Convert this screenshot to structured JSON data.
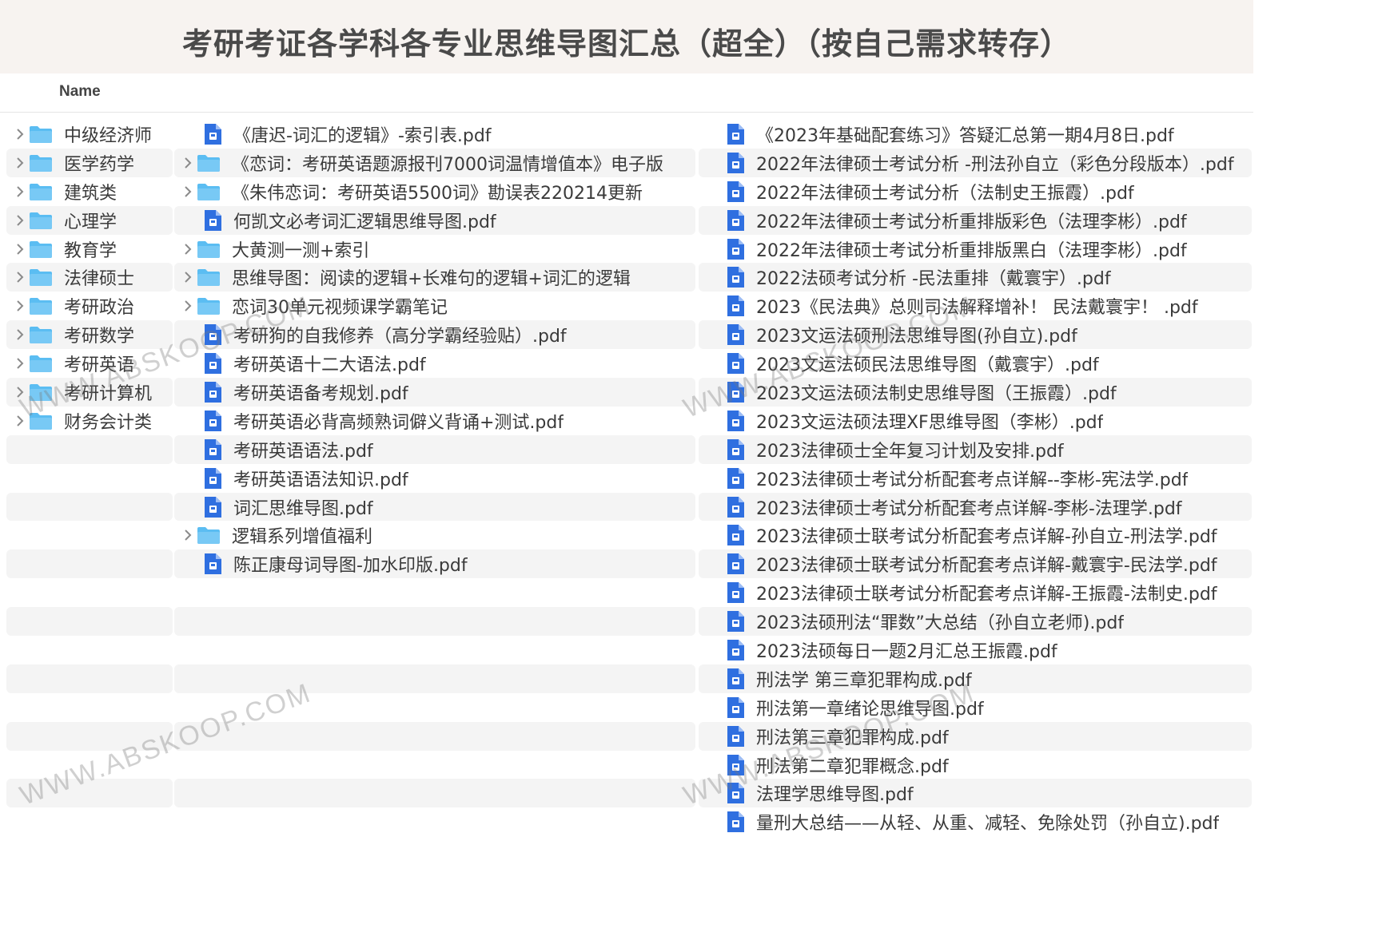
{
  "page_title": "考研考证各学科各专业思维导图汇总（超全）（按自己需求转存）",
  "header": {
    "name_label": "Name"
  },
  "watermark_text": "WWW.ABSKOOP.COM",
  "sidebar": {
    "items": [
      {
        "label": "中级经济师"
      },
      {
        "label": "医学药学"
      },
      {
        "label": "建筑类"
      },
      {
        "label": "心理学"
      },
      {
        "label": "教育学"
      },
      {
        "label": "法律硕士"
      },
      {
        "label": "考研政治"
      },
      {
        "label": "考研数学"
      },
      {
        "label": "考研英语"
      },
      {
        "label": "考研计算机"
      },
      {
        "label": "财务会计类"
      }
    ]
  },
  "middle": {
    "items": [
      {
        "type": "file",
        "label": "《唐迟-词汇的逻辑》-索引表.pdf"
      },
      {
        "type": "folder",
        "label": "《恋词：考研英语题源报刊7000词温情增值本》电子版"
      },
      {
        "type": "folder",
        "label": "《朱伟恋词：考研英语5500词》勘误表220214更新"
      },
      {
        "type": "file",
        "label": "何凯文必考词汇逻辑思维导图.pdf"
      },
      {
        "type": "folder",
        "label": "大黄测一测+索引"
      },
      {
        "type": "folder",
        "label": "思维导图：阅读的逻辑+长难句的逻辑+词汇的逻辑"
      },
      {
        "type": "folder",
        "label": "恋词30单元视频课学霸笔记"
      },
      {
        "type": "file",
        "label": "考研狗的自我修养（高分学霸经验贴）.pdf"
      },
      {
        "type": "file",
        "label": "考研英语十二大语法.pdf"
      },
      {
        "type": "file",
        "label": "考研英语备考规划.pdf"
      },
      {
        "type": "file",
        "label": "考研英语必背高频熟词僻义背诵+测试.pdf"
      },
      {
        "type": "file",
        "label": "考研英语语法.pdf"
      },
      {
        "type": "file",
        "label": "考研英语语法知识.pdf"
      },
      {
        "type": "file",
        "label": "词汇思维导图.pdf"
      },
      {
        "type": "folder",
        "label": "逻辑系列增值福利"
      },
      {
        "type": "file",
        "label": "陈正康母词导图-加水印版.pdf"
      }
    ]
  },
  "right": {
    "items": [
      {
        "label": "《2023年基础配套练习》答疑汇总第一期4月8日.pdf"
      },
      {
        "label": "2022年法律硕士考试分析 -刑法孙自立（彩色分段版本）.pdf"
      },
      {
        "label": "2022年法律硕士考试分析（法制史王振霞）.pdf"
      },
      {
        "label": "2022年法律硕士考试分析重排版彩色（法理李彬）.pdf"
      },
      {
        "label": "2022年法律硕士考试分析重排版黑白（法理李彬）.pdf"
      },
      {
        "label": "2022法硕考试分析 -民法重排（戴寰宇）.pdf"
      },
      {
        "label": "2023《民法典》总则司法解释增补！ 民法戴寰宇！ .pdf"
      },
      {
        "label": "2023文运法硕刑法思维导图(孙自立).pdf"
      },
      {
        "label": "2023文运法硕民法思维导图（戴寰宇）.pdf"
      },
      {
        "label": "2023文运法硕法制史思维导图（王振霞）.pdf"
      },
      {
        "label": "2023文运法硕法理XF思维导图（李彬）.pdf"
      },
      {
        "label": "2023法律硕士全年复习计划及安排.pdf"
      },
      {
        "label": "2023法律硕士考试分析配套考点详解--李彬-宪法学.pdf"
      },
      {
        "label": "2023法律硕士考试分析配套考点详解-李彬-法理学.pdf"
      },
      {
        "label": "2023法律硕士联考试分析配套考点详解-孙自立-刑法学.pdf"
      },
      {
        "label": "2023法律硕士联考试分析配套考点详解-戴寰宇-民法学.pdf"
      },
      {
        "label": "2023法律硕士联考试分析配套考点详解-王振霞-法制史.pdf"
      },
      {
        "label": "2023法硕刑法“罪数”大总结（孙自立老师).pdf"
      },
      {
        "label": "2023法硕每日一题2月汇总王振霞.pdf"
      },
      {
        "label": "刑法学 第三章犯罪构成.pdf"
      },
      {
        "label": "刑法第一章绪论思维导图.pdf"
      },
      {
        "label": "刑法第三章犯罪构成.pdf"
      },
      {
        "label": "刑法第二章犯罪概念.pdf"
      },
      {
        "label": "法理学思维导图.pdf"
      },
      {
        "label": "量刑大总结——从轻、从重、减轻、免除处罚（孙自立).pdf"
      }
    ]
  },
  "colors": {
    "folder": "#5bbdf2",
    "pdf": "#2f6fe0",
    "stripe": "#f4f4f4",
    "title_bg": "#f7f3f0"
  }
}
